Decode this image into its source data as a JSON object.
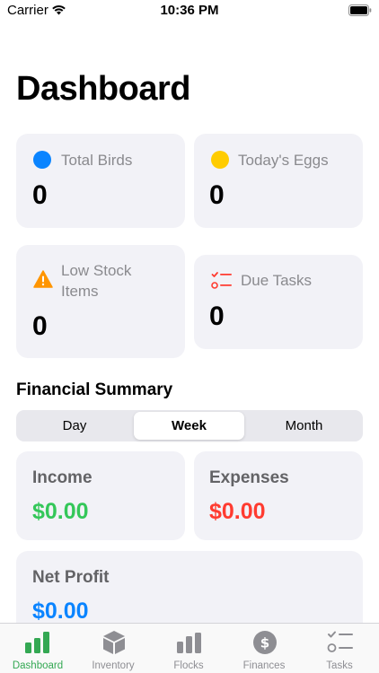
{
  "status_bar": {
    "carrier": "Carrier",
    "time": "10:36 PM"
  },
  "page": {
    "title": "Dashboard"
  },
  "stats": {
    "total_birds": {
      "label": "Total Birds",
      "value": "0",
      "icon": "blue-circle-icon",
      "color": "#0a84ff"
    },
    "todays_eggs": {
      "label": "Today's Eggs",
      "value": "0",
      "icon": "yellow-circle-icon",
      "color": "#ffcc00"
    },
    "low_stock": {
      "label_line1": "Low Stock",
      "label_line2": "Items",
      "value": "0",
      "icon": "warning-triangle-icon",
      "color": "#ff9500"
    },
    "due_tasks": {
      "label": "Due Tasks",
      "value": "0",
      "icon": "checklist-icon",
      "color": "#ff3b30"
    }
  },
  "financial_summary": {
    "title": "Financial Summary",
    "periods": [
      "Day",
      "Week",
      "Month"
    ],
    "selected_period": "Week",
    "income": {
      "label": "Income",
      "value": "$0.00",
      "color": "#34c759"
    },
    "expenses": {
      "label": "Expenses",
      "value": "$0.00",
      "color": "#ff3b30"
    },
    "net_profit": {
      "label": "Net Profit",
      "value": "$0.00",
      "color": "#0a84ff"
    }
  },
  "tab_bar": {
    "selected": "Dashboard",
    "active_color": "#34a853",
    "items": [
      {
        "label": "Dashboard",
        "icon": "bar-chart-icon"
      },
      {
        "label": "Inventory",
        "icon": "box-icon"
      },
      {
        "label": "Flocks",
        "icon": "flocks-chart-icon"
      },
      {
        "label": "Finances",
        "icon": "dollar-circle-icon"
      },
      {
        "label": "Tasks",
        "icon": "checklist-icon"
      }
    ]
  }
}
